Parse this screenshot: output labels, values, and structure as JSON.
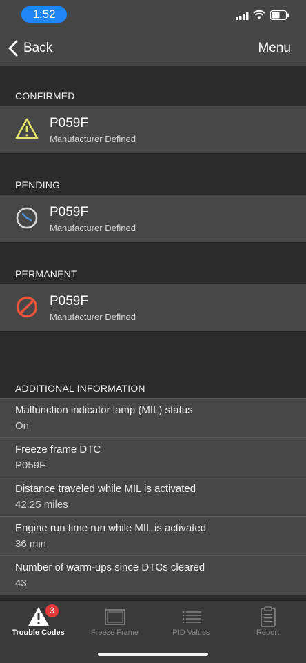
{
  "status_bar": {
    "time": "1:52"
  },
  "nav": {
    "back_label": "Back",
    "menu_label": "Menu"
  },
  "sections": {
    "confirmed": {
      "header": "CONFIRMED",
      "code": "P059F",
      "description": "Manufacturer Defined",
      "icon": "warning-icon"
    },
    "pending": {
      "header": "PENDING",
      "code": "P059F",
      "description": "Manufacturer Defined",
      "icon": "clock-icon"
    },
    "permanent": {
      "header": "PERMANENT",
      "code": "P059F",
      "description": "Manufacturer Defined",
      "icon": "prohibited-icon"
    }
  },
  "additional_info": {
    "header": "ADDITIONAL INFORMATION",
    "items": [
      {
        "label": "Malfunction indicator lamp (MIL) status",
        "value": "On"
      },
      {
        "label": "Freeze frame DTC",
        "value": "P059F"
      },
      {
        "label": "Distance traveled while MIL is activated",
        "value": "42.25 miles"
      },
      {
        "label": "Engine run time run while MIL is activated",
        "value": "36 min"
      },
      {
        "label": "Number of warm-ups since DTCs cleared",
        "value": "43"
      }
    ]
  },
  "tabs": [
    {
      "label": "Trouble Codes",
      "badge": "3",
      "active": true,
      "icon": "warning-icon"
    },
    {
      "label": "Freeze Frame",
      "active": false,
      "icon": "frame-icon"
    },
    {
      "label": "PID Values",
      "active": false,
      "icon": "list-icon"
    },
    {
      "label": "Report",
      "active": false,
      "icon": "clipboard-icon"
    }
  ],
  "colors": {
    "accent_blue": "#1e86f5",
    "warning_yellow": "#e2e36b",
    "clock_blue": "#4a8fd8",
    "prohibited_red": "#e8553a",
    "badge_red": "#e23a3a"
  }
}
